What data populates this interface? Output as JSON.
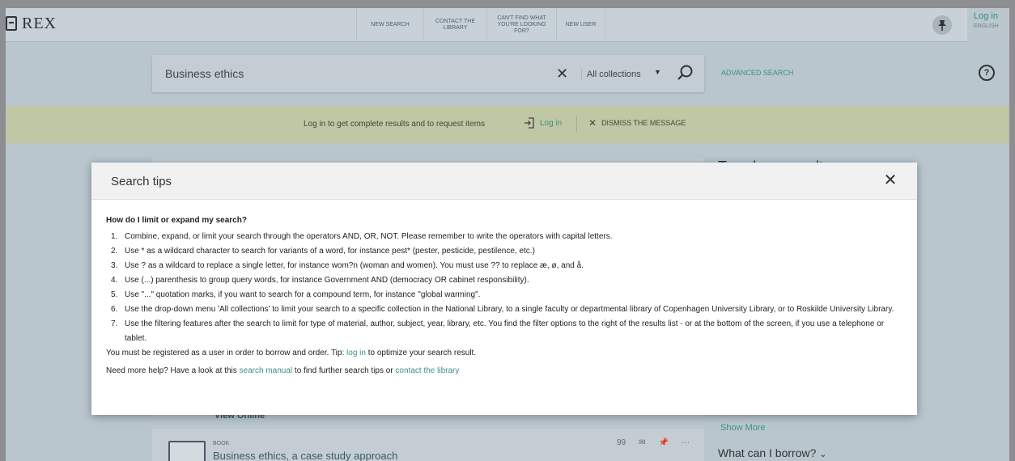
{
  "header": {
    "logo_text": "REX",
    "nav": [
      "NEW SEARCH",
      "CONTACT THE LIBRARY",
      "CAN'T FIND WHAT YOU'RE LOOKING FOR?",
      "NEW USER"
    ],
    "login_label": "Log in",
    "language_label": "ENGLISH"
  },
  "search": {
    "value": "Business ethics",
    "clear_icon": "close-icon",
    "collection_selected": "All collections",
    "advanced_label": "ADVANCED SEARCH"
  },
  "notice": {
    "text": "Log in to get complete results and to request items",
    "login_label": "Log in",
    "dismiss_label": "DISMISS THE MESSAGE"
  },
  "results": {
    "view_online_label": "View Online",
    "book_type": "BOOK",
    "book_title": "Business ethics, a case study approach",
    "actions": [
      "99",
      "✉",
      "📌",
      "···"
    ]
  },
  "sidebar": {
    "heading": "Tweak my results",
    "show_more": "Show More",
    "what_can_i_borrow": "What can I borrow?"
  },
  "modal": {
    "title": "Search tips",
    "question": "How do I limit or expand my search?",
    "tips": [
      "Combine, expand, or limit your search through the operators AND, OR, NOT. Please remember to write the operators with capital letters.",
      "Use * as a wildcard character to search for variants of a word, for instance pest* (pester, pesticide, pestilence, etc.)",
      "Use ? as a wildcard to replace a single letter, for instance wom?n (woman and women). You must use ?? to replace æ, ø, and å.",
      "Use (...) parenthesis to group query words, for instance Government AND (democracy OR cabinet responsibility).",
      "Use \"...\" quotation marks, if you want to search for a compound term, for instance \"global warming\".",
      "Use the drop-down menu 'All collections' to limit your search to a specific collection in the National Library, to a single faculty or departmental library of Copenhagen University Library, or to Roskilde University Library.",
      "Use the filtering features after the search to limit for type of material, author, subject, year, library, etc. You find the filter options to the right of the results list - or at the bottom of the screen, if you use a telephone or tablet."
    ],
    "register_text_before": "You must be registered as a user in order to borrow and order. Tip: ",
    "register_link": "log in",
    "register_text_after": " to optimize your search result.",
    "help_text_before": "Need more help? Have a look at this ",
    "help_link_manual": "search manual",
    "help_text_middle": " to find further search tips or ",
    "help_link_contact": "contact the library"
  }
}
